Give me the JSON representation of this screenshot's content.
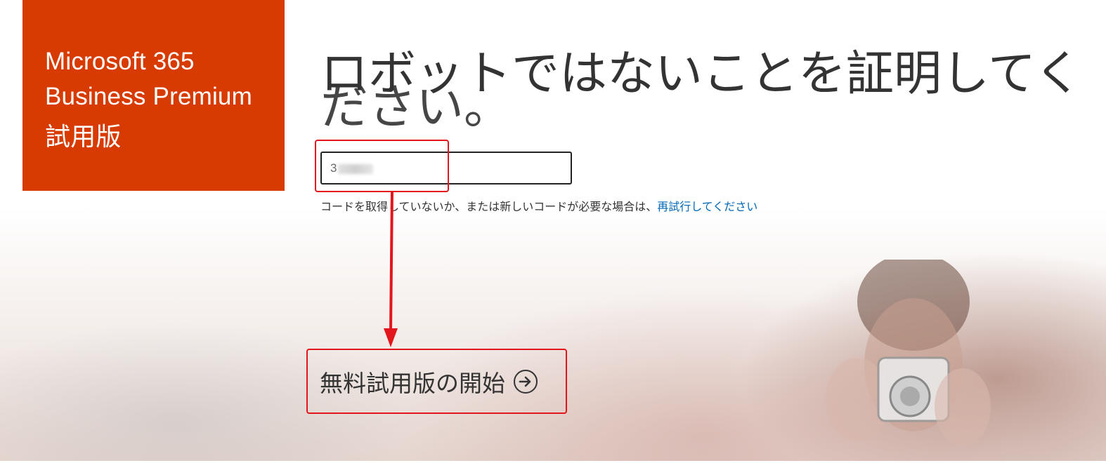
{
  "brand": {
    "line1": "Microsoft 365",
    "line2": "Business Premium",
    "line3": "試用版",
    "color": "#d83b01"
  },
  "heading": {
    "text": "ロボットではないことを証明してく",
    "overflow_text": "ださい。"
  },
  "code_input": {
    "value": "3"
  },
  "hint": {
    "text": "コードを取得していないか、または新しいコードが必要な場合は、",
    "link": "再試行してください"
  },
  "start_button": {
    "label": "無料試用版の開始",
    "icon": "arrow-right-circle-icon"
  },
  "annotation": {
    "color": "#e4161d"
  }
}
